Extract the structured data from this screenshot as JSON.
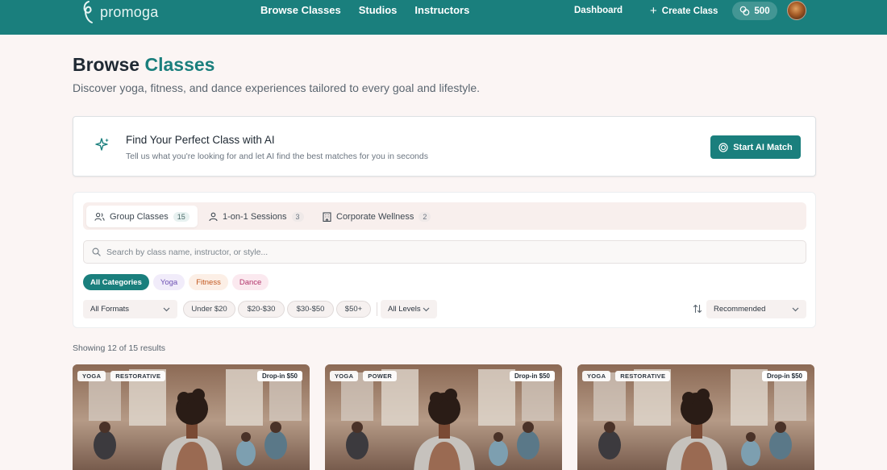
{
  "brand": {
    "name": "promoga"
  },
  "nav": {
    "links": [
      "Browse Classes",
      "Studios",
      "Instructors"
    ],
    "dashboard": "Dashboard",
    "create_class": "Create Class",
    "credits": "500"
  },
  "header": {
    "title_part1": "Browse",
    "title_part2": "Classes",
    "subtitle": "Discover yoga, fitness, and dance experiences tailored to every goal and lifestyle."
  },
  "ai_match": {
    "title": "Find Your Perfect Class with AI",
    "description": "Tell us what you're looking for and let AI find the best matches for you in seconds",
    "button": "Start AI Match"
  },
  "tabs": [
    {
      "label": "Group Classes",
      "count": "15",
      "active": true,
      "icon": "users-icon"
    },
    {
      "label": "1-on-1 Sessions",
      "count": "3",
      "active": false,
      "icon": "user-icon"
    },
    {
      "label": "Corporate Wellness",
      "count": "2",
      "active": false,
      "icon": "building-icon"
    }
  ],
  "search": {
    "placeholder": "Search by class name, instructor, or style..."
  },
  "categories": [
    {
      "label": "All Categories",
      "active": true
    },
    {
      "label": "Yoga"
    },
    {
      "label": "Fitness"
    },
    {
      "label": "Dance"
    }
  ],
  "filters": {
    "format": "All Formats",
    "prices": [
      "Under $20",
      "$20-$30",
      "$30-$50",
      "$50+"
    ],
    "level": "All Levels",
    "sort": "Recommended"
  },
  "results_text": "Showing 12 of 15 results",
  "cards": [
    {
      "tags": [
        "YOGA",
        "RESTORATIVE"
      ],
      "price": "Drop-in $50"
    },
    {
      "tags": [
        "YOGA",
        "POWER"
      ],
      "price": "Drop-in $50"
    },
    {
      "tags": [
        "YOGA",
        "RESTORATIVE"
      ],
      "price": "Drop-in $50"
    }
  ],
  "colors": {
    "brand": "#1a7f7d",
    "background": "#fbf5f4"
  }
}
